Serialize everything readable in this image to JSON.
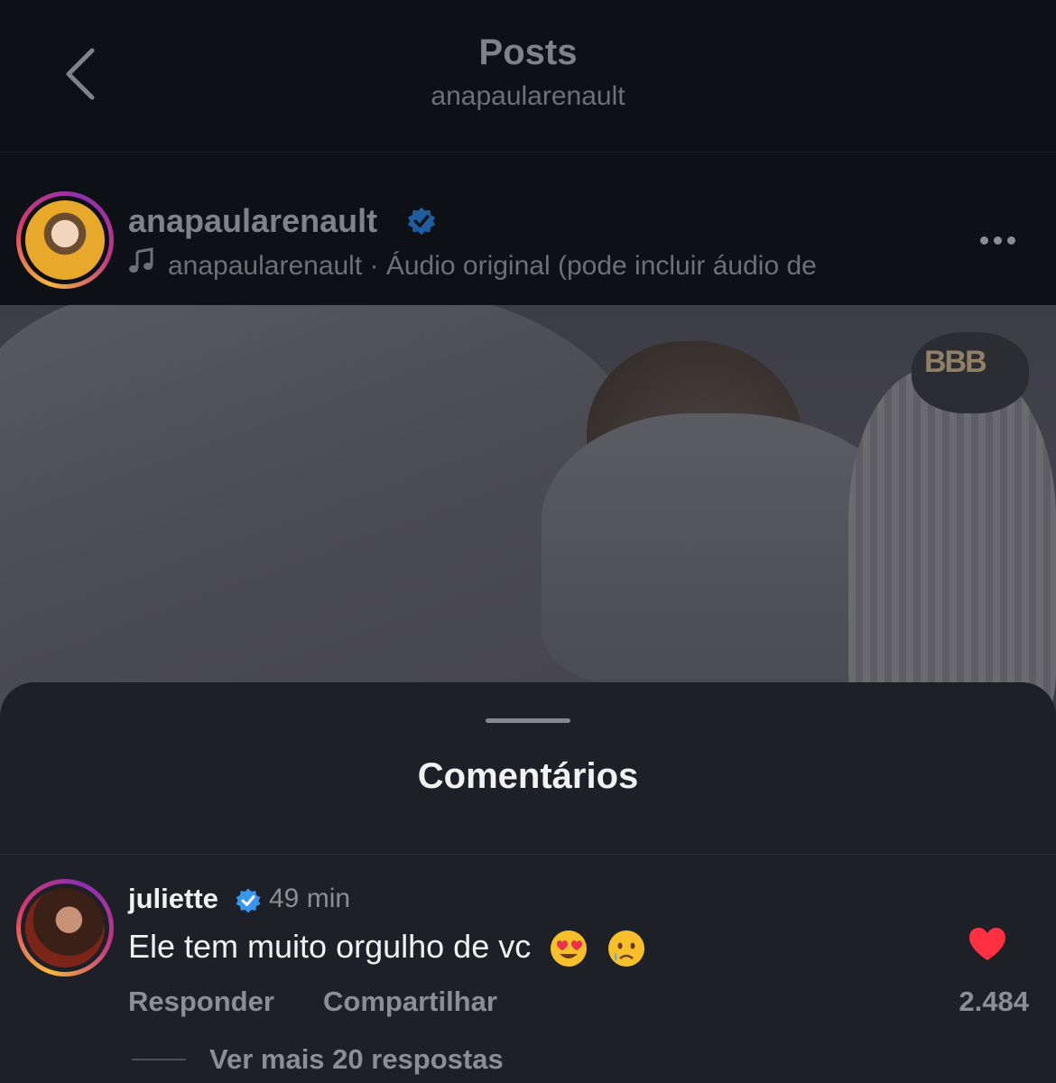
{
  "header": {
    "title": "Posts",
    "subtitle": "anapaularenault",
    "back_icon": "chevron-left-icon"
  },
  "post": {
    "username": "anapaularenault",
    "verified_icon": "verified-badge-icon",
    "audio_icon": "music-note-icon",
    "audio_text": "anapaularenault · Áudio original  (pode incluir áudio de",
    "more_icon": "more-horizontal-icon",
    "media_watermark": "BBB"
  },
  "comments_sheet": {
    "title": "Comentários",
    "comments": [
      {
        "username": "juliette",
        "time": "49 min",
        "text": "Ele tem muito orgulho de vc",
        "emojis": [
          "heart-eyes-emoji",
          "crying-emoji"
        ],
        "reply_label": "Responder",
        "share_label": "Compartilhar",
        "likes": "2.484",
        "liked": true,
        "view_replies_label": "Ver mais 20 respostas"
      }
    ]
  },
  "colors": {
    "background": "#0c0f14",
    "sheet": "#1d2026",
    "verified_blue": "#3797f0",
    "heart_red": "#ff3040"
  }
}
